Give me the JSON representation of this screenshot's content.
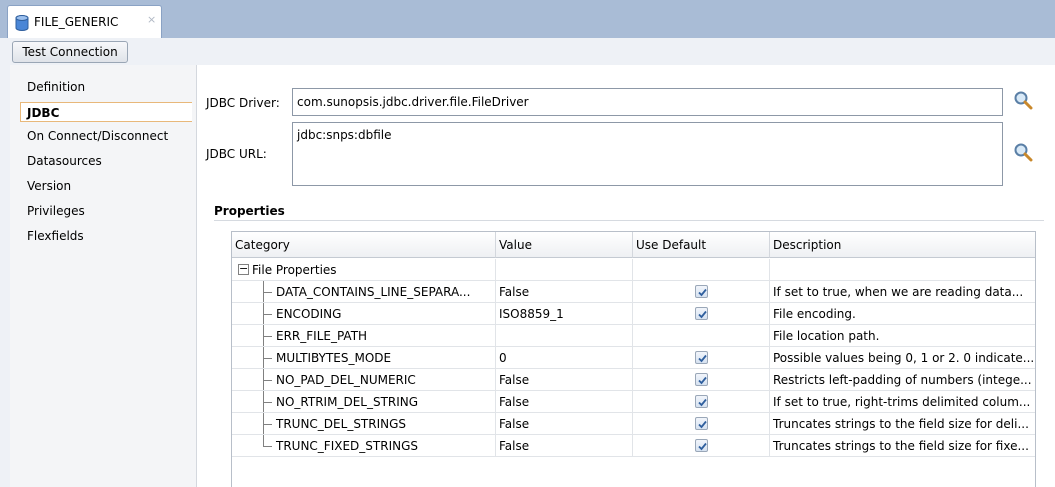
{
  "window": {
    "tab_title": "FILE_GENERIC",
    "tab_close": "×",
    "toolbar": {
      "test_connection": "Test Connection"
    }
  },
  "sidebar": {
    "items": [
      {
        "label": "Definition"
      },
      {
        "label": "JDBC"
      },
      {
        "label": "On Connect/Disconnect"
      },
      {
        "label": "Datasources"
      },
      {
        "label": "Version"
      },
      {
        "label": "Privileges"
      },
      {
        "label": "Flexfields"
      }
    ],
    "active_index": 1
  },
  "jdbc": {
    "driver_label": "JDBC Driver:",
    "driver_value": "com.sunopsis.jdbc.driver.file.FileDriver",
    "url_label": "JDBC URL:",
    "url_value": "jdbc:snps:dbfile"
  },
  "properties": {
    "section_title": "Properties",
    "columns": [
      "Category",
      "Value",
      "Use Default",
      "Description"
    ],
    "group": {
      "expander": "−",
      "label": "File Properties"
    },
    "rows": [
      {
        "name": "DATA_CONTAINS_LINE_SEPARA...",
        "value": "False",
        "use_default": true,
        "description": "If set to true, when we are reading data..."
      },
      {
        "name": "ENCODING",
        "value": "ISO8859_1",
        "use_default": true,
        "description": "File encoding."
      },
      {
        "name": "ERR_FILE_PATH",
        "value": "",
        "use_default": false,
        "description": "File location path."
      },
      {
        "name": "MULTIBYTES_MODE",
        "value": "0",
        "use_default": true,
        "description": "Possible values being 0, 1 or 2. 0 indicate..."
      },
      {
        "name": "NO_PAD_DEL_NUMERIC",
        "value": "False",
        "use_default": true,
        "description": "Restricts left-padding of numbers (intege..."
      },
      {
        "name": "NO_RTRIM_DEL_STRING",
        "value": "False",
        "use_default": true,
        "description": "If set to true, right-trims delimited colum..."
      },
      {
        "name": "TRUNC_DEL_STRINGS",
        "value": "False",
        "use_default": true,
        "description": "Truncates strings to the field size for deli..."
      },
      {
        "name": "TRUNC_FIXED_STRINGS",
        "value": "False",
        "use_default": true,
        "description": "Truncates strings to the field size for fixe..."
      }
    ]
  },
  "colors": {
    "tabstrip": "#a9bcd6",
    "active_border": "#e8b87a",
    "checkbox_check": "#2f5f9e"
  }
}
